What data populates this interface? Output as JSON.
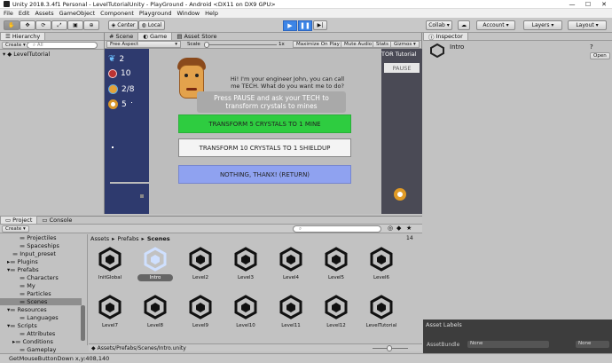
{
  "window": {
    "title": "Unity 2018.3.4f1 Personal - LevelTutorialUnity - PlayGround - Android <DX11 on DX9 GPU>",
    "min": "—",
    "max": "☐",
    "close": "✕"
  },
  "menu": [
    "File",
    "Edit",
    "Assets",
    "GameObject",
    "Component",
    "Playground",
    "Window",
    "Help"
  ],
  "toolbar": {
    "center": "Center",
    "local": "Local",
    "collab": "Collab ▾",
    "account": "Account",
    "layers": "Layers",
    "layout": "Layout"
  },
  "hierarchy": {
    "tab": "Hierarchy",
    "create": "Create ▾",
    "search": "All",
    "root": "LevelTutorial"
  },
  "scene_tabs": {
    "scene": "Scene",
    "game": "Game",
    "asset_store": "Asset Store"
  },
  "game_bar": {
    "aspect": "Free Aspect",
    "scale_label": "Scale",
    "scale_val": "1x",
    "maximize": "Maximize On Play",
    "mute": "Mute Audio",
    "stats": "Stats",
    "gizmos": "Gizmos ▾"
  },
  "game": {
    "stats": [
      {
        "icon": "bird-icon",
        "value": "2"
      },
      {
        "icon": "crystal-icon",
        "value": "10"
      },
      {
        "icon": "shield-icon",
        "value": "2/8"
      },
      {
        "icon": "gear-icon",
        "value": "5"
      }
    ],
    "dialog": "Hi! I'm your engineer John, you can call me TECH. What do you want me to do?",
    "hint": "Press PAUSE and ask your TECH to transform crystals to mines",
    "options": [
      "TRANSFORM 5 CRYSTALS TO 1 MINE",
      "TRANSFORM 10 CRYSTALS TO 1 SHIELDUP",
      "NOTHING, THANX! (RETURN)"
    ],
    "tutorial": "TOR Tutorial",
    "pause": "PAUSE"
  },
  "inspector": {
    "tab": "Inspector",
    "name": "Intro",
    "open": "Open"
  },
  "project": {
    "tabs": [
      "Project",
      "Console"
    ],
    "create": "Create ▾",
    "tree": [
      "Projectiles",
      "Spaceships",
      "Input_preset",
      "Plugins",
      "Prefabs",
      "Characters",
      "My",
      "Particles",
      "Scenes",
      "Resources",
      "Languages",
      "Scripts",
      "Attributes",
      "Conditions",
      "Gameplay"
    ],
    "breadcrumb": [
      "Assets",
      "Prefabs",
      "Scenes"
    ],
    "assets": [
      "InitGlobal",
      "Intro",
      "Level2",
      "Level3",
      "Level4",
      "Level5",
      "Level6",
      "Level7",
      "Level8",
      "Level9",
      "Level10",
      "Level11",
      "Level12",
      "LevelTutorial"
    ],
    "path": "Assets/Prefabs/Scenes/Intro.unity",
    "count": "14"
  },
  "asset_labels": {
    "title": "Asset Labels",
    "bundle_label": "AssetBundle",
    "bundle_val": "None",
    "variant_val": "None"
  },
  "status": "GetMouseButtonDown x,y:408,140"
}
